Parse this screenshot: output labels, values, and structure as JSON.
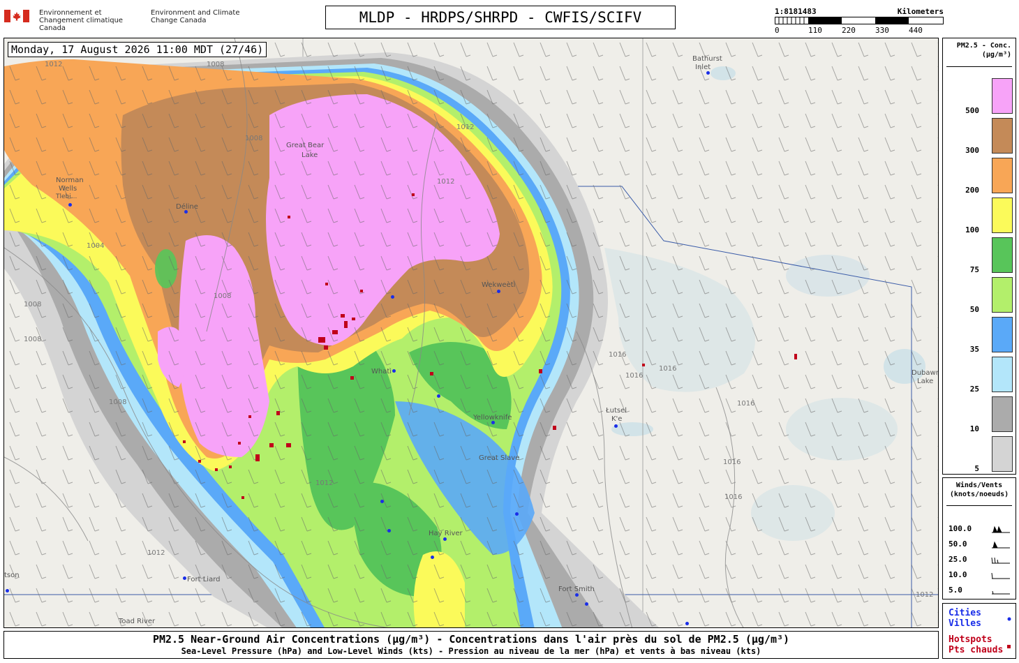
{
  "header": {
    "department_fr": "Environnement et Changement climatique Canada",
    "department_en": "Environment and Climate Change Canada",
    "model_title": "MLDP - HRDPS/SHRPD - CWFIS/SCIFV"
  },
  "scale": {
    "ratio": "1:8181483",
    "unit": "Kilometers",
    "ticks": [
      "0",
      "110",
      "220",
      "330",
      "440"
    ]
  },
  "map": {
    "timestamp": "Monday, 17 August 2026 11:00 MDT (27/46)",
    "places": {
      "bathurst_inlet_1": "Bathurst",
      "bathurst_inlet_2": "Inlet",
      "norman_wells_1": "Norman",
      "norman_wells_2": "Wells",
      "tulita": "Tlebi...",
      "delina": "Déline",
      "great_bear_1": "Great Bear",
      "great_bear_2": "Lake",
      "wekweeti": "Wekweètì",
      "whati": "Whatì",
      "yellowknife": "Yellowknife",
      "great_slave": "Great Slave",
      "lutsel_ke_1": "Łutsel",
      "lutsel_ke_2": "K'e",
      "hay_river": "Hay River",
      "fort_liard": "Fort Liard",
      "fort_smith": "Fort Smith",
      "watson_lake": "tson",
      "toad_river": "Toad River",
      "dubawnt_1": "Dubawnt",
      "dubawnt_2": "Lake"
    },
    "isobars": [
      "1012",
      "1008",
      "1008",
      "1004",
      "1008",
      "1012",
      "1012",
      "1016",
      "1016",
      "1016",
      "1016",
      "1016",
      "1016",
      "1008",
      "1008",
      "1008",
      "1012",
      "1012",
      "1012"
    ]
  },
  "legend_concentration": {
    "title_1": "PM2.5 - Conc.",
    "title_2": "(µg/m³)",
    "levels": [
      {
        "label": "500",
        "color": "#f7a3f8"
      },
      {
        "label": "300",
        "color": "#c48a58"
      },
      {
        "label": "200",
        "color": "#f8a656"
      },
      {
        "label": "100",
        "color": "#fbfa5a"
      },
      {
        "label": "75",
        "color": "#58c55a"
      },
      {
        "label": "50",
        "color": "#b3ef6b"
      },
      {
        "label": "35",
        "color": "#5aa9f8"
      },
      {
        "label": "25",
        "color": "#b3e6fa"
      },
      {
        "label": "10",
        "color": "#ababab"
      },
      {
        "label": "5",
        "color": "#d4d4d4"
      }
    ]
  },
  "legend_wind": {
    "title_1": "Winds/Vents",
    "title_2": "(knots/noeuds)",
    "rows": [
      {
        "label": "100.0",
        "barb": "pennant-2"
      },
      {
        "label": "50.0",
        "barb": "pennant"
      },
      {
        "label": "25.0",
        "barb": "barb-3"
      },
      {
        "label": "10.0",
        "barb": "barb-1"
      },
      {
        "label": "5.0",
        "barb": "barb-half"
      }
    ]
  },
  "legend_markers": {
    "cities_en": "Cities",
    "cities_fr": "Villes",
    "cities_color": "#1a2ee8",
    "hotspots_en": "Hotspots",
    "hotspots_fr": "Pts chauds",
    "hotspots_color": "#c0001a"
  },
  "caption": {
    "line_1": "PM2.5 Near-Ground Air Concentrations (µg/m³) - Concentrations dans l'air près du sol de PM2.5 (µg/m³)",
    "line_2": "Sea-Level Pressure (hPa) and Low-Level Winds (kts) - Pression au niveau de la mer (hPa) et vents à bas niveau (kts)"
  }
}
